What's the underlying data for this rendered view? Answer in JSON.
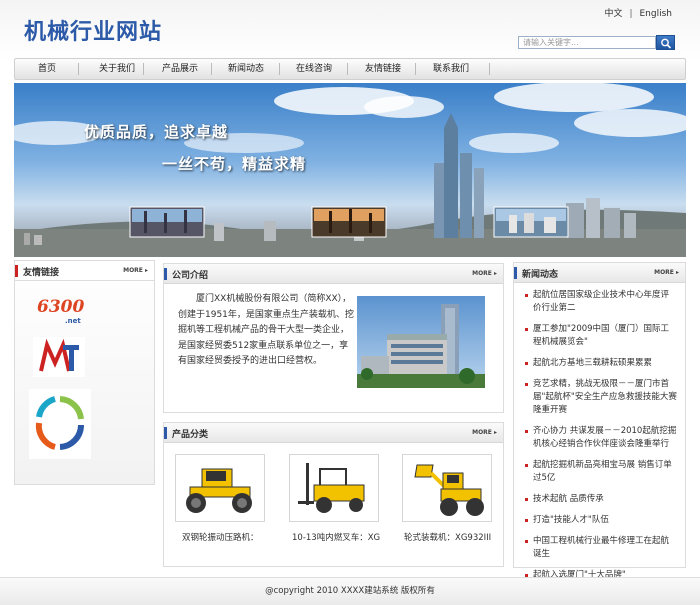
{
  "header": {
    "logo_text": "机械行业网站",
    "lang_cn": "中文",
    "lang_sep": "|",
    "lang_en": "English",
    "search_placeholder": "请输入关键字..."
  },
  "nav": {
    "items": [
      "首页",
      "关于我们",
      "产品展示",
      "新闻动态",
      "在线咨询",
      "友情链接",
      "联系我们"
    ]
  },
  "banner": {
    "line1": "优质品质，追求卓越",
    "line2": "一丝不苟，精益求精"
  },
  "links_panel": {
    "title": "友情链接",
    "more": "MORE",
    "logo1_text": "6300",
    "logo1_sub": ".net"
  },
  "about_panel": {
    "title": "公司介绍",
    "more": "MORE",
    "text": "厦门XX机械股份有限公司（简称XX），创建于1951年，是国家重点生产装载机、挖掘机等工程机械产品的骨干大型一类企业，是国家经贸委512家重点联系单位之一，享有国家经贸委授予的进出口经营权。"
  },
  "products_panel": {
    "title": "产品分类",
    "more": "MORE",
    "items": [
      {
        "label": "双钢轮振动压路机："
      },
      {
        "label": "10-13吨内燃叉车：XG"
      },
      {
        "label": "轮式装载机：XG932III"
      }
    ]
  },
  "news_panel": {
    "title": "新闻动态",
    "more": "MORE",
    "items": [
      "起航位居国家级企业技术中心年度评价行业第二",
      "厦工参加\"2009中国（厦门）国际工程机械展览会\"",
      "起航北方基地三载耕耘硕果累累",
      "竞艺求精，挑战无极限－－厦门市首届\"起航杯\"安全生产应急救援技能大赛隆重开赛",
      "齐心协力 共谋发展－－2010起航挖掘机核心经销合作伙伴座谈会隆重举行",
      "起航挖掘机新品亮相宝马展 销售订单过5亿",
      "技术起航 品质传承",
      "打造\"技能人才\"队伍",
      "中国工程机械行业最牛修理工在起航诞生",
      "起航入选厦门\"十大品牌\""
    ]
  },
  "footer": {
    "text": "@copyright  2010 XXXX建站系统  版权所有"
  },
  "colors": {
    "brand_blue": "#2c5aa8",
    "bullet_red": "#cc2222",
    "machine_yellow": "#f2c200"
  }
}
